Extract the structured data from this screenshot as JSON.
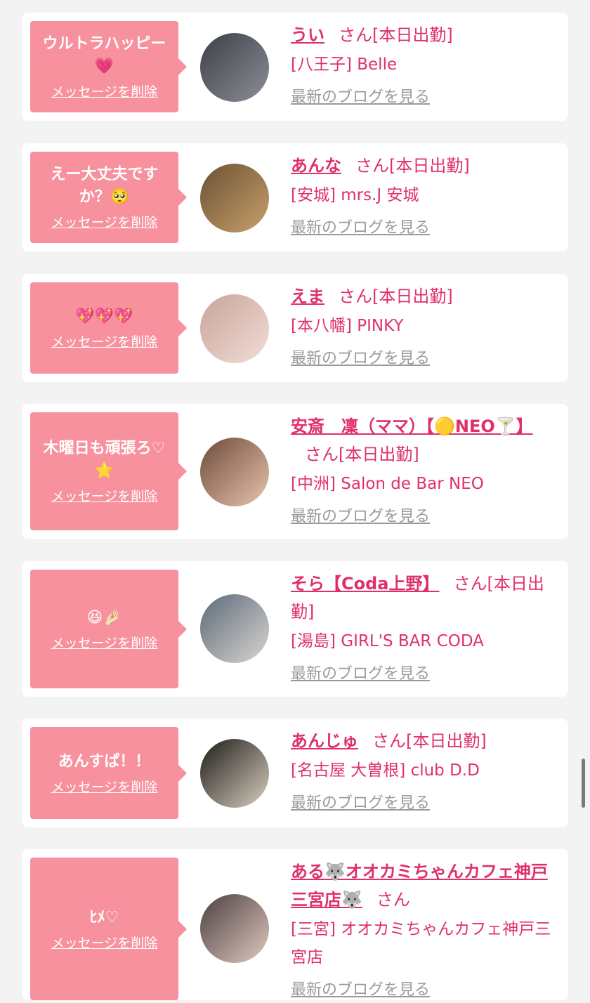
{
  "colors": {
    "background": "#f3f3f3",
    "card": "#ffffff",
    "bubble": "#f7919d",
    "accent": "#e0306a",
    "link_gray": "#9a9a9a"
  },
  "delete_label": "メッセージを削除",
  "blog_label": "最新のブログを見る",
  "cards": [
    {
      "message": "ウルトラハッピー💗",
      "name": "うい",
      "suffix": "さん[本日出勤]",
      "shop": "[八王子] Belle",
      "avatar_icon": "avatar-photo",
      "avatar_colors": [
        "#3d3f47",
        "#8d8f98"
      ]
    },
    {
      "message": "えー大丈夫ですか？🥺",
      "name": "あんな",
      "suffix": "さん[本日出勤]",
      "shop": "[安城] mrs.J 安城",
      "avatar_icon": "avatar-photo",
      "avatar_colors": [
        "#6b5133",
        "#c8a06c"
      ]
    },
    {
      "message": "💖💖💖",
      "name": "えま",
      "suffix": "さん[本日出勤]",
      "shop": "[本八幡] PINKY",
      "avatar_icon": "avatar-photo",
      "avatar_colors": [
        "#c9a49a",
        "#f1ddd6"
      ]
    },
    {
      "message": "木曜日も頑張ろ♡⭐",
      "name": "安斎　凜（ママ）【🟡NEO🍸】",
      "suffix": "さん[本日出勤]",
      "shop": "[中洲] Salon de Bar NEO",
      "avatar_icon": "avatar-photo",
      "avatar_colors": [
        "#6e4a3a",
        "#e8c5ad"
      ]
    },
    {
      "message": "😆🤌🏻",
      "name": "そら【Coda上野】",
      "suffix": "さん[本日出勤]",
      "shop": "[湯島] GIRL'S BAR CODA",
      "avatar_icon": "avatar-photo",
      "avatar_colors": [
        "#5c6a7a",
        "#d9d6cf"
      ]
    },
    {
      "message": "あんすぱ！！",
      "name": "あんじゅ",
      "suffix": "さん[本日出勤]",
      "shop": "[名古屋 大曽根] club D.D",
      "avatar_icon": "avatar-photo",
      "avatar_colors": [
        "#1e1b18",
        "#d8cfc0"
      ]
    },
    {
      "message": "ﾋﾒ♡",
      "name": "ある🐺オオカミちゃんカフェ神戸三宮店🐺",
      "suffix": "さん",
      "shop": "[三宮] オオカミちゃんカフェ神戸三宮店",
      "avatar_icon": "avatar-photo",
      "avatar_colors": [
        "#4a4040",
        "#e2c8c0"
      ]
    }
  ]
}
